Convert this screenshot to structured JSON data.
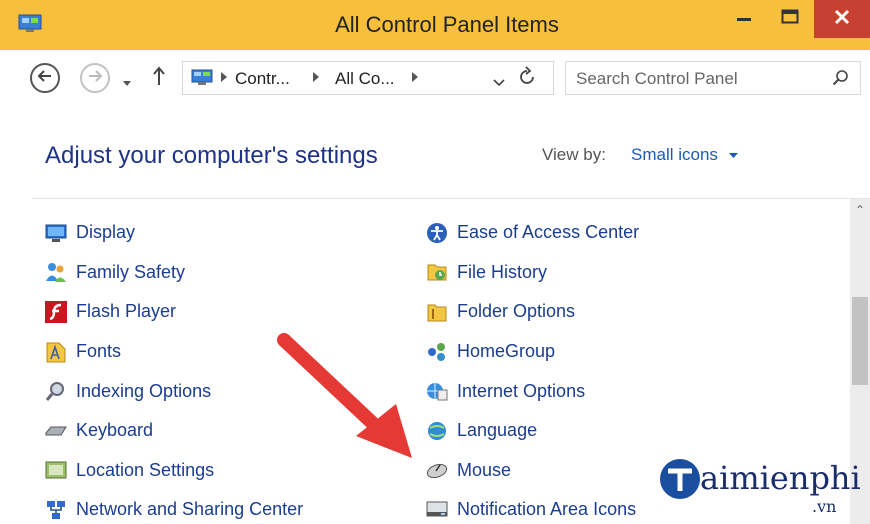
{
  "window": {
    "title": "All Control Panel Items",
    "close_color": "#c84031",
    "titlebar_color": "#f7bf3c"
  },
  "navigation": {
    "breadcrumbs": [
      "Contr...",
      "All Co..."
    ],
    "search_placeholder": "Search Control Panel"
  },
  "main": {
    "heading": "Adjust your computer's settings",
    "view_by_label": "View by:",
    "view_by_value": "Small icons"
  },
  "items_left": [
    {
      "label": "Display",
      "icon": "display-icon"
    },
    {
      "label": "Family Safety",
      "icon": "family-safety-icon"
    },
    {
      "label": "Flash Player",
      "icon": "flash-player-icon"
    },
    {
      "label": "Fonts",
      "icon": "fonts-icon"
    },
    {
      "label": "Indexing Options",
      "icon": "indexing-options-icon"
    },
    {
      "label": "Keyboard",
      "icon": "keyboard-icon"
    },
    {
      "label": "Location Settings",
      "icon": "location-settings-icon"
    },
    {
      "label": "Network and Sharing Center",
      "icon": "network-icon"
    }
  ],
  "items_right": [
    {
      "label": "Ease of Access Center",
      "icon": "ease-of-access-icon"
    },
    {
      "label": "File History",
      "icon": "file-history-icon"
    },
    {
      "label": "Folder Options",
      "icon": "folder-options-icon"
    },
    {
      "label": "HomeGroup",
      "icon": "homegroup-icon"
    },
    {
      "label": "Internet Options",
      "icon": "internet-options-icon"
    },
    {
      "label": "Language",
      "icon": "language-icon"
    },
    {
      "label": "Mouse",
      "icon": "mouse-icon"
    },
    {
      "label": "Notification Area Icons",
      "icon": "notification-area-icon"
    }
  ],
  "watermark": {
    "text": "aimienphi",
    "suffix": ".vn"
  },
  "annotation": {
    "arrow_color": "#e53935"
  }
}
